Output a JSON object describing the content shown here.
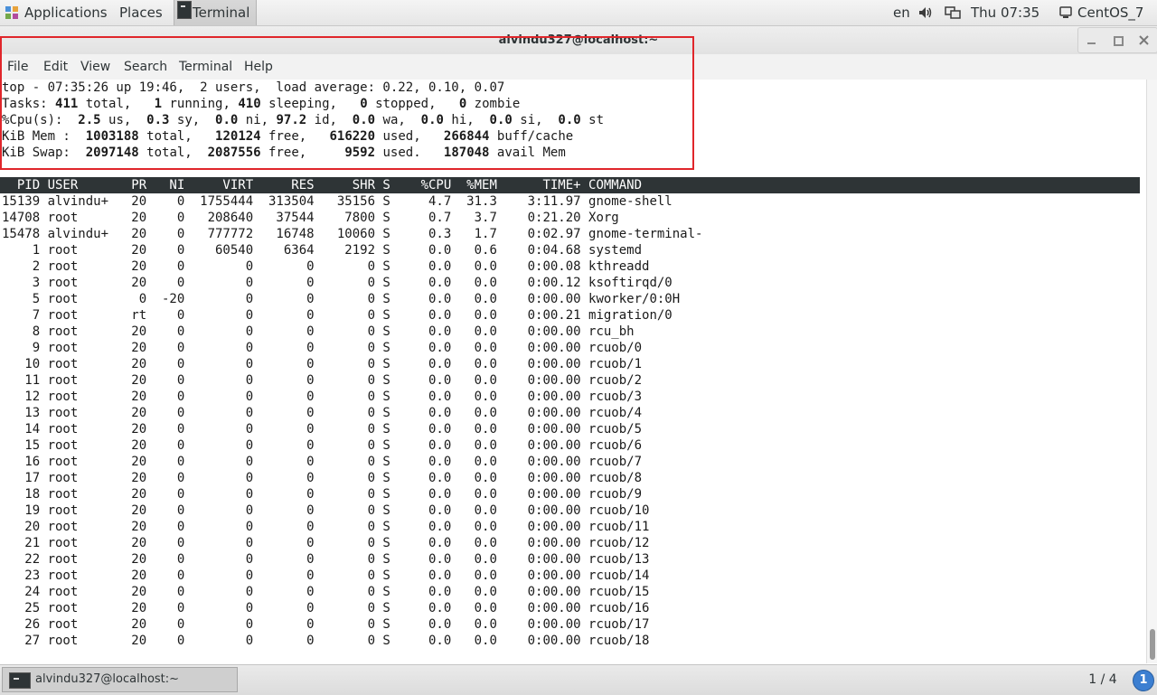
{
  "topbar": {
    "applications": "Applications",
    "places": "Places",
    "terminal_task": "Terminal",
    "language": "en",
    "clock": "Thu 07:35",
    "user": "CentOS_7"
  },
  "window": {
    "title": "alvindu327@localhost:~"
  },
  "menu": [
    "File",
    "Edit",
    "View",
    "Search",
    "Terminal",
    "Help"
  ],
  "summary": [
    [
      {
        "t": "top - 07:35:26 up 19:46,  2 users,  load average: 0.22, 0.10, 0.07"
      }
    ],
    [
      {
        "t": "Tasks: "
      },
      {
        "t": "411",
        "b": true
      },
      {
        "t": " total,   "
      },
      {
        "t": "1",
        "b": true
      },
      {
        "t": " running, "
      },
      {
        "t": "410",
        "b": true
      },
      {
        "t": " sleeping,   "
      },
      {
        "t": "0",
        "b": true
      },
      {
        "t": " stopped,   "
      },
      {
        "t": "0",
        "b": true
      },
      {
        "t": " zombie"
      }
    ],
    [
      {
        "t": "%Cpu(s):  "
      },
      {
        "t": "2.5",
        "b": true
      },
      {
        "t": " us,  "
      },
      {
        "t": "0.3",
        "b": true
      },
      {
        "t": " sy,  "
      },
      {
        "t": "0.0",
        "b": true
      },
      {
        "t": " ni, "
      },
      {
        "t": "97.2",
        "b": true
      },
      {
        "t": " id,  "
      },
      {
        "t": "0.0",
        "b": true
      },
      {
        "t": " wa,  "
      },
      {
        "t": "0.0",
        "b": true
      },
      {
        "t": " hi,  "
      },
      {
        "t": "0.0",
        "b": true
      },
      {
        "t": " si,  "
      },
      {
        "t": "0.0",
        "b": true
      },
      {
        "t": " st"
      }
    ],
    [
      {
        "t": "KiB Mem :  "
      },
      {
        "t": "1003188",
        "b": true
      },
      {
        "t": " total,   "
      },
      {
        "t": "120124",
        "b": true
      },
      {
        "t": " free,   "
      },
      {
        "t": "616220",
        "b": true
      },
      {
        "t": " used,   "
      },
      {
        "t": "266844",
        "b": true
      },
      {
        "t": " buff/cache"
      }
    ],
    [
      {
        "t": "KiB Swap:  "
      },
      {
        "t": "2097148",
        "b": true
      },
      {
        "t": " total,  "
      },
      {
        "t": "2087556",
        "b": true
      },
      {
        "t": " free,     "
      },
      {
        "t": "9592",
        "b": true
      },
      {
        "t": " used.   "
      },
      {
        "t": "187048",
        "b": true
      },
      {
        "t": " avail Mem"
      }
    ]
  ],
  "columns": [
    "PID",
    "USER",
    "PR",
    "NI",
    "VIRT",
    "RES",
    "SHR",
    "S",
    "%CPU",
    "%MEM",
    "TIME+",
    "COMMAND"
  ],
  "processes": [
    [
      "15139",
      "alvindu+",
      "20",
      "0",
      "1755444",
      "313504",
      "35156",
      "S",
      "4.7",
      "31.3",
      "3:11.97",
      "gnome-shell"
    ],
    [
      "14708",
      "root",
      "20",
      "0",
      "208640",
      "37544",
      "7800",
      "S",
      "0.7",
      "3.7",
      "0:21.20",
      "Xorg"
    ],
    [
      "15478",
      "alvindu+",
      "20",
      "0",
      "777772",
      "16748",
      "10060",
      "S",
      "0.3",
      "1.7",
      "0:02.97",
      "gnome-terminal-"
    ],
    [
      "1",
      "root",
      "20",
      "0",
      "60540",
      "6364",
      "2192",
      "S",
      "0.0",
      "0.6",
      "0:04.68",
      "systemd"
    ],
    [
      "2",
      "root",
      "20",
      "0",
      "0",
      "0",
      "0",
      "S",
      "0.0",
      "0.0",
      "0:00.08",
      "kthreadd"
    ],
    [
      "3",
      "root",
      "20",
      "0",
      "0",
      "0",
      "0",
      "S",
      "0.0",
      "0.0",
      "0:00.12",
      "ksoftirqd/0"
    ],
    [
      "5",
      "root",
      "0",
      "-20",
      "0",
      "0",
      "0",
      "S",
      "0.0",
      "0.0",
      "0:00.00",
      "kworker/0:0H"
    ],
    [
      "7",
      "root",
      "rt",
      "0",
      "0",
      "0",
      "0",
      "S",
      "0.0",
      "0.0",
      "0:00.21",
      "migration/0"
    ],
    [
      "8",
      "root",
      "20",
      "0",
      "0",
      "0",
      "0",
      "S",
      "0.0",
      "0.0",
      "0:00.00",
      "rcu_bh"
    ],
    [
      "9",
      "root",
      "20",
      "0",
      "0",
      "0",
      "0",
      "S",
      "0.0",
      "0.0",
      "0:00.00",
      "rcuob/0"
    ],
    [
      "10",
      "root",
      "20",
      "0",
      "0",
      "0",
      "0",
      "S",
      "0.0",
      "0.0",
      "0:00.00",
      "rcuob/1"
    ],
    [
      "11",
      "root",
      "20",
      "0",
      "0",
      "0",
      "0",
      "S",
      "0.0",
      "0.0",
      "0:00.00",
      "rcuob/2"
    ],
    [
      "12",
      "root",
      "20",
      "0",
      "0",
      "0",
      "0",
      "S",
      "0.0",
      "0.0",
      "0:00.00",
      "rcuob/3"
    ],
    [
      "13",
      "root",
      "20",
      "0",
      "0",
      "0",
      "0",
      "S",
      "0.0",
      "0.0",
      "0:00.00",
      "rcuob/4"
    ],
    [
      "14",
      "root",
      "20",
      "0",
      "0",
      "0",
      "0",
      "S",
      "0.0",
      "0.0",
      "0:00.00",
      "rcuob/5"
    ],
    [
      "15",
      "root",
      "20",
      "0",
      "0",
      "0",
      "0",
      "S",
      "0.0",
      "0.0",
      "0:00.00",
      "rcuob/6"
    ],
    [
      "16",
      "root",
      "20",
      "0",
      "0",
      "0",
      "0",
      "S",
      "0.0",
      "0.0",
      "0:00.00",
      "rcuob/7"
    ],
    [
      "17",
      "root",
      "20",
      "0",
      "0",
      "0",
      "0",
      "S",
      "0.0",
      "0.0",
      "0:00.00",
      "rcuob/8"
    ],
    [
      "18",
      "root",
      "20",
      "0",
      "0",
      "0",
      "0",
      "S",
      "0.0",
      "0.0",
      "0:00.00",
      "rcuob/9"
    ],
    [
      "19",
      "root",
      "20",
      "0",
      "0",
      "0",
      "0",
      "S",
      "0.0",
      "0.0",
      "0:00.00",
      "rcuob/10"
    ],
    [
      "20",
      "root",
      "20",
      "0",
      "0",
      "0",
      "0",
      "S",
      "0.0",
      "0.0",
      "0:00.00",
      "rcuob/11"
    ],
    [
      "21",
      "root",
      "20",
      "0",
      "0",
      "0",
      "0",
      "S",
      "0.0",
      "0.0",
      "0:00.00",
      "rcuob/12"
    ],
    [
      "22",
      "root",
      "20",
      "0",
      "0",
      "0",
      "0",
      "S",
      "0.0",
      "0.0",
      "0:00.00",
      "rcuob/13"
    ],
    [
      "23",
      "root",
      "20",
      "0",
      "0",
      "0",
      "0",
      "S",
      "0.0",
      "0.0",
      "0:00.00",
      "rcuob/14"
    ],
    [
      "24",
      "root",
      "20",
      "0",
      "0",
      "0",
      "0",
      "S",
      "0.0",
      "0.0",
      "0:00.00",
      "rcuob/15"
    ],
    [
      "25",
      "root",
      "20",
      "0",
      "0",
      "0",
      "0",
      "S",
      "0.0",
      "0.0",
      "0:00.00",
      "rcuob/16"
    ],
    [
      "26",
      "root",
      "20",
      "0",
      "0",
      "0",
      "0",
      "S",
      "0.0",
      "0.0",
      "0:00.00",
      "rcuob/17"
    ],
    [
      "27",
      "root",
      "20",
      "0",
      "0",
      "0",
      "0",
      "S",
      "0.0",
      "0.0",
      "0:00.00",
      "rcuob/18"
    ]
  ],
  "taskbar": {
    "window_label": "alvindu327@localhost:~",
    "workspace": "1 / 4",
    "notification_count": "1"
  },
  "colors": {
    "highlight": "#e0262b",
    "header_bg": "#2e3436",
    "notification": "#3c7fd1"
  },
  "icons": [
    "applications-icon",
    "terminal-icon",
    "volume-icon",
    "network-icon",
    "user-icon",
    "minimize-icon",
    "maximize-icon",
    "close-icon"
  ]
}
